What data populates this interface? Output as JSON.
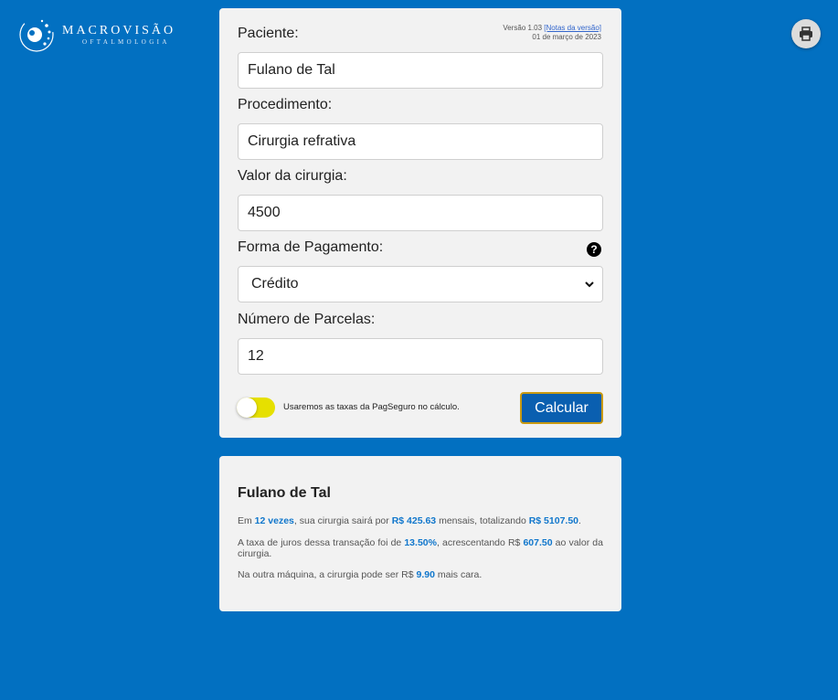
{
  "brand": {
    "name": "MACROVISÃO",
    "subtitle": "OFTALMOLOGIA"
  },
  "header": {
    "print_icon": "printer-icon"
  },
  "version": {
    "text": "Versão 1.03",
    "notes_link": "[Notas da versão]",
    "date": "01 de março de 2023"
  },
  "form": {
    "patient_label": "Paciente:",
    "patient_value": "Fulano de Tal",
    "procedure_label": "Procedimento:",
    "procedure_value": "Cirurgia refrativa",
    "value_label": "Valor da cirurgia:",
    "value_value": "4500",
    "payment_label": "Forma de Pagamento:",
    "payment_value": "Crédito",
    "installments_label": "Número de Parcelas:",
    "installments_value": "12",
    "toggle_text": "Usaremos as taxas da PagSeguro no cálculo.",
    "toggle_on": true,
    "submit_label": "Calcular"
  },
  "result": {
    "name": "Fulano de Tal",
    "p1_a": "Em ",
    "p1_installments": "12 vezes",
    "p1_b": ", sua cirurgia sairá por ",
    "p1_monthly": "R$ 425.63",
    "p1_c": " mensais, totalizando ",
    "p1_total": "R$ 5107.50",
    "p1_d": ".",
    "p2_a": "A taxa de juros dessa transação foi de ",
    "p2_rate": "13.50%",
    "p2_b": ", acrescentando R$ ",
    "p2_added": "607.50",
    "p2_c": " ao valor da cirurgia.",
    "p3_a": "Na outra máquina, a cirurgia pode ser R$ ",
    "p3_value": "9.90",
    "p3_b": " mais cara."
  },
  "colors": {
    "background": "#0270c1",
    "accent": "#1177cc",
    "toggle": "#e6e000",
    "button": "#0a5fb0"
  }
}
